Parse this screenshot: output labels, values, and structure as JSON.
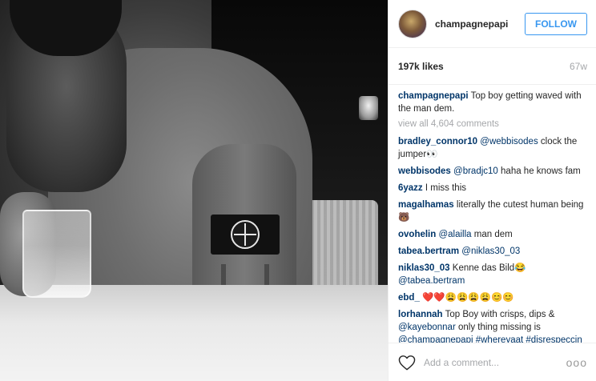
{
  "post": {
    "photo_alt": "",
    "header": {
      "username": "champagnepapi",
      "follow_label": "FOLLOW"
    },
    "stats": {
      "likes": "197k likes",
      "age": "67w"
    },
    "caption": {
      "author": "champagnepapi",
      "text": "Top boy getting waved with the man dem."
    },
    "view_all_label": "view all 4,604 comments",
    "comments": [
      {
        "author": "bradley_connor10",
        "mention": "@webbisodes",
        "text": "clock the jumper👀"
      },
      {
        "author": "webbisodes",
        "mention": "@bradjc10",
        "text": "haha he knows fam"
      },
      {
        "author": "6yazz",
        "mention": "",
        "text": "I miss this"
      },
      {
        "author": "magalhamas",
        "mention": "",
        "text": "literally the cutest human being 🐻"
      },
      {
        "author": "ovohelin",
        "mention": "@alailla",
        "text": "man dem"
      },
      {
        "author": "tabea.bertram",
        "mention": "@niklas30_03",
        "text": ""
      },
      {
        "author": "niklas30_03",
        "mention": "",
        "text": "Kenne das Bild😂",
        "mention_after": "@tabea.bertram"
      },
      {
        "author": "ebd_",
        "mention": "",
        "text": "❤️❤️😩😩😩😩😊😊"
      },
      {
        "author": "lorhannah",
        "mention": "",
        "text": "Top Boy with crisps, dips &",
        "mention_after": "@kayebonnar",
        "text_after": "only thing missing is",
        "mention_end": "@champagnepapi",
        "tag1": "#whereyaat",
        "tag2": "#disrespeccin"
      }
    ],
    "add_comment": {
      "placeholder": "Add a comment...",
      "more_label": "ooo"
    }
  },
  "colors": {
    "accent": "#3897f0",
    "link": "#003569",
    "muted": "#a5a7aa",
    "text": "#262626"
  },
  "icons": {
    "like": "heart-outline-icon",
    "more": "ellipsis-icon"
  }
}
